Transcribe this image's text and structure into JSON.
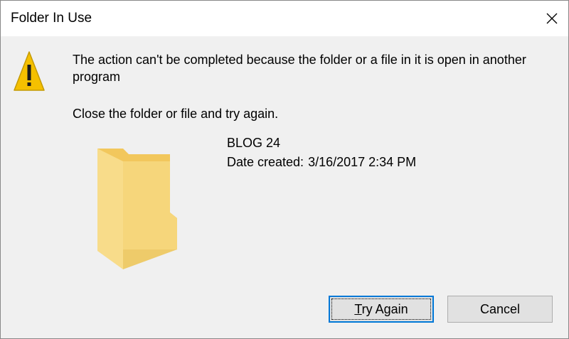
{
  "window": {
    "title": "Folder In Use",
    "close_icon": "close-icon"
  },
  "message": {
    "icon": "warning-icon",
    "primary": "The action can't be completed because the folder or a file in it is open in another program",
    "secondary": "Close the folder or file and try again."
  },
  "item": {
    "icon": "folder-icon",
    "name": "BLOG 24",
    "date_label": "Date created:",
    "date_value": "3/16/2017 2:34 PM"
  },
  "buttons": {
    "try_again": "Try Again",
    "cancel": "Cancel"
  },
  "colors": {
    "titlebar": "#ffffff",
    "body": "#f0f0f0",
    "accent": "#0078d7",
    "warning": "#f5c000",
    "folder": "#f6d67b"
  }
}
